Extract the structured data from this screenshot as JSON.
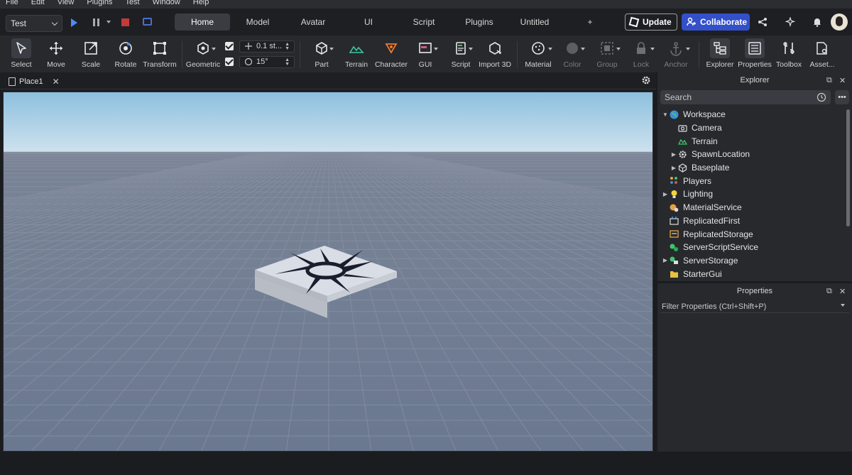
{
  "menu": [
    "File",
    "Edit",
    "View",
    "Plugins",
    "Test",
    "Window",
    "Help"
  ],
  "toolbar": {
    "mode_select": "Test",
    "tabs": [
      "Home",
      "Model",
      "Avatar",
      "UI",
      "Script",
      "Plugins",
      "Untitled",
      "+"
    ],
    "active_tab": "Home",
    "update_label": "Update",
    "collaborate_label": "Collaborate"
  },
  "ribbon": {
    "tools": [
      {
        "label": "Select",
        "icon": "cursor-icon"
      },
      {
        "label": "Move",
        "icon": "move-icon"
      },
      {
        "label": "Scale",
        "icon": "scale-icon"
      },
      {
        "label": "Rotate",
        "icon": "rotate-icon"
      },
      {
        "label": "Transform",
        "icon": "transform-icon"
      },
      {
        "label": "Geometric",
        "icon": "geometric-icon"
      },
      {
        "label": "Part",
        "icon": "part-icon"
      },
      {
        "label": "Terrain",
        "icon": "terrain-icon"
      },
      {
        "label": "Character",
        "icon": "character-icon"
      },
      {
        "label": "GUI",
        "icon": "gui-icon"
      },
      {
        "label": "Script",
        "icon": "script-icon"
      },
      {
        "label": "Import 3D",
        "icon": "import-3d-icon"
      },
      {
        "label": "Material",
        "icon": "material-icon"
      },
      {
        "label": "Color",
        "icon": "color-icon"
      },
      {
        "label": "Group",
        "icon": "group-icon"
      },
      {
        "label": "Lock",
        "icon": "lock-icon"
      },
      {
        "label": "Anchor",
        "icon": "anchor-icon"
      },
      {
        "label": "Explorer",
        "icon": "explorer-icon"
      },
      {
        "label": "Properties",
        "icon": "properties-icon"
      },
      {
        "label": "Toolbox",
        "icon": "toolbox-icon"
      },
      {
        "label": "Asset...",
        "icon": "asset-manager-icon"
      }
    ],
    "move_snap": "0.1 st...",
    "rotate_snap": "15°"
  },
  "document": {
    "tab_label": "Place1",
    "close_glyph": "✕"
  },
  "explorer": {
    "title": "Explorer",
    "search_placeholder": "Search",
    "items": [
      {
        "label": "Workspace",
        "expanded": true,
        "level": 0,
        "icon": "globe-icon"
      },
      {
        "label": "Camera",
        "level": 1,
        "icon": "camera-icon"
      },
      {
        "label": "Terrain",
        "level": 1,
        "icon": "terrain-icon"
      },
      {
        "label": "SpawnLocation",
        "level": 1,
        "collapsed": true,
        "icon": "gear-icon"
      },
      {
        "label": "Baseplate",
        "level": 1,
        "collapsed": true,
        "icon": "cube-icon"
      },
      {
        "label": "Players",
        "level": 0,
        "icon": "players-icon"
      },
      {
        "label": "Lighting",
        "level": 0,
        "collapsed": true,
        "icon": "bulb-icon"
      },
      {
        "label": "MaterialService",
        "level": 0,
        "icon": "material-service-icon"
      },
      {
        "label": "ReplicatedFirst",
        "level": 0,
        "icon": "replicated-first-icon"
      },
      {
        "label": "ReplicatedStorage",
        "level": 0,
        "icon": "replicated-storage-icon"
      },
      {
        "label": "ServerScriptService",
        "level": 0,
        "icon": "server-script-icon"
      },
      {
        "label": "ServerStorage",
        "level": 0,
        "collapsed": true,
        "icon": "server-storage-icon"
      },
      {
        "label": "StarterGui",
        "level": 0,
        "icon": "starter-gui-icon"
      }
    ]
  },
  "properties": {
    "title": "Properties",
    "filter_placeholder": "Filter Properties (Ctrl+Shift+P)"
  },
  "colors": {
    "accent": "#3350c9",
    "play": "#4a8cff",
    "stop": "#c23b3b",
    "sky_top": "#8fc2e0",
    "ground": "#6e7a90"
  }
}
